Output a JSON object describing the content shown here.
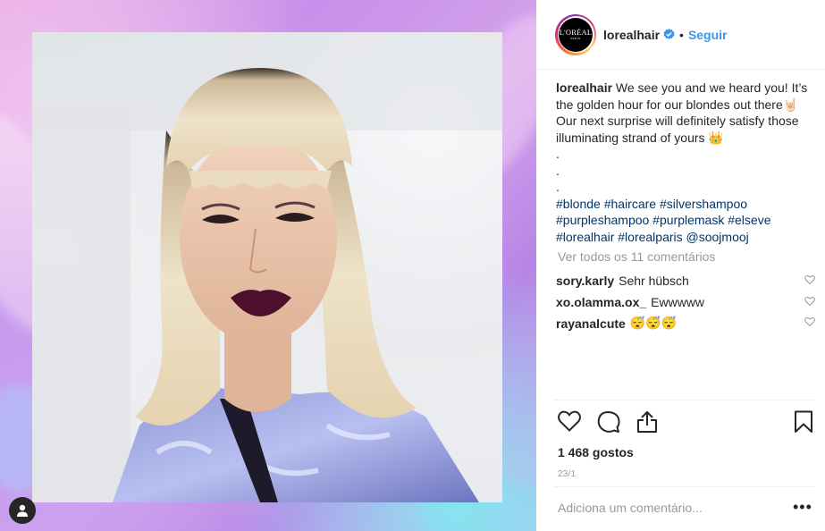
{
  "post": {
    "username": "lorealhair",
    "follow_label": "Seguir",
    "separator": "•",
    "avatar": {
      "brand": "L'ORÉAL",
      "sub": "PARIS"
    },
    "caption": {
      "lines": [
        "We see you and we heard you! It’s",
        "the golden hour for our blondes out there🤘🏻",
        "Our next surprise will definitely satisfy those",
        "illuminating strand of yours 👑",
        ".",
        ".",
        "."
      ],
      "hashtag_lines": [
        "#blonde #haircare #silvershampoo",
        "#purpleshampoo #purplemask #elseve",
        "#lorealhair #lorealparis @soojmooj"
      ]
    },
    "view_all_comments": "Ver todos os 11 comentários",
    "comments": [
      {
        "user": "sory.karly",
        "text": "Sehr hübsch"
      },
      {
        "user": "xo.olamma.ox_",
        "text": "Ewwwww"
      },
      {
        "user": "rayanalcute",
        "text": "😴😴😴"
      }
    ],
    "likes": "1 468 gostos",
    "date": "23/1",
    "comment_placeholder": "Adiciona um comentário...",
    "more_label": "•••"
  },
  "icons": [
    "verified-badge-icon",
    "heart-icon",
    "comment-icon",
    "share-icon",
    "bookmark-icon",
    "user-icon"
  ],
  "colors": {
    "link": "#3897f0",
    "hashtag": "#003569",
    "muted": "#999999",
    "text": "#262626"
  }
}
